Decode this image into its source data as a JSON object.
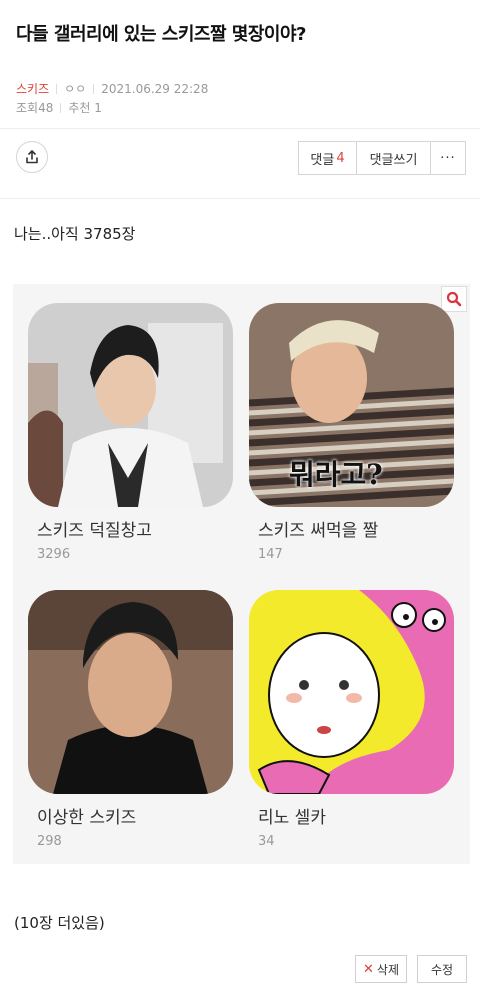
{
  "post": {
    "title": "다들 갤러리에 있는 스키즈짤 몇장이야?",
    "author": "스키즈",
    "author_badge": "ㅇㅇ",
    "date": "2021.06.29 22:28",
    "views_label": "조회",
    "views": "48",
    "recommend_label": "추천",
    "recommend": "1",
    "body_text": "나는..아직 3785장",
    "footer_text": "(10장 더있음)"
  },
  "actions": {
    "comments_label": "댓글",
    "comments_count": "4",
    "write_comment": "댓글쓰기",
    "more": "···",
    "delete": "삭제",
    "edit": "수정"
  },
  "gallery": {
    "cards": [
      {
        "name": "스키즈 덕질창고",
        "count": "3296"
      },
      {
        "name": "스키즈 써먹을 짤",
        "count": "147",
        "overlay_text": "뭐라고?"
      },
      {
        "name": "이상한 스키즈",
        "count": "298"
      },
      {
        "name": "리노 셀카",
        "count": "34"
      }
    ]
  },
  "colors": {
    "accent": "#e0423a",
    "muted": "#999999",
    "border": "#d5d5d5"
  },
  "icons": {
    "share": "share-icon",
    "search": "search-icon",
    "delete": "x-icon"
  }
}
